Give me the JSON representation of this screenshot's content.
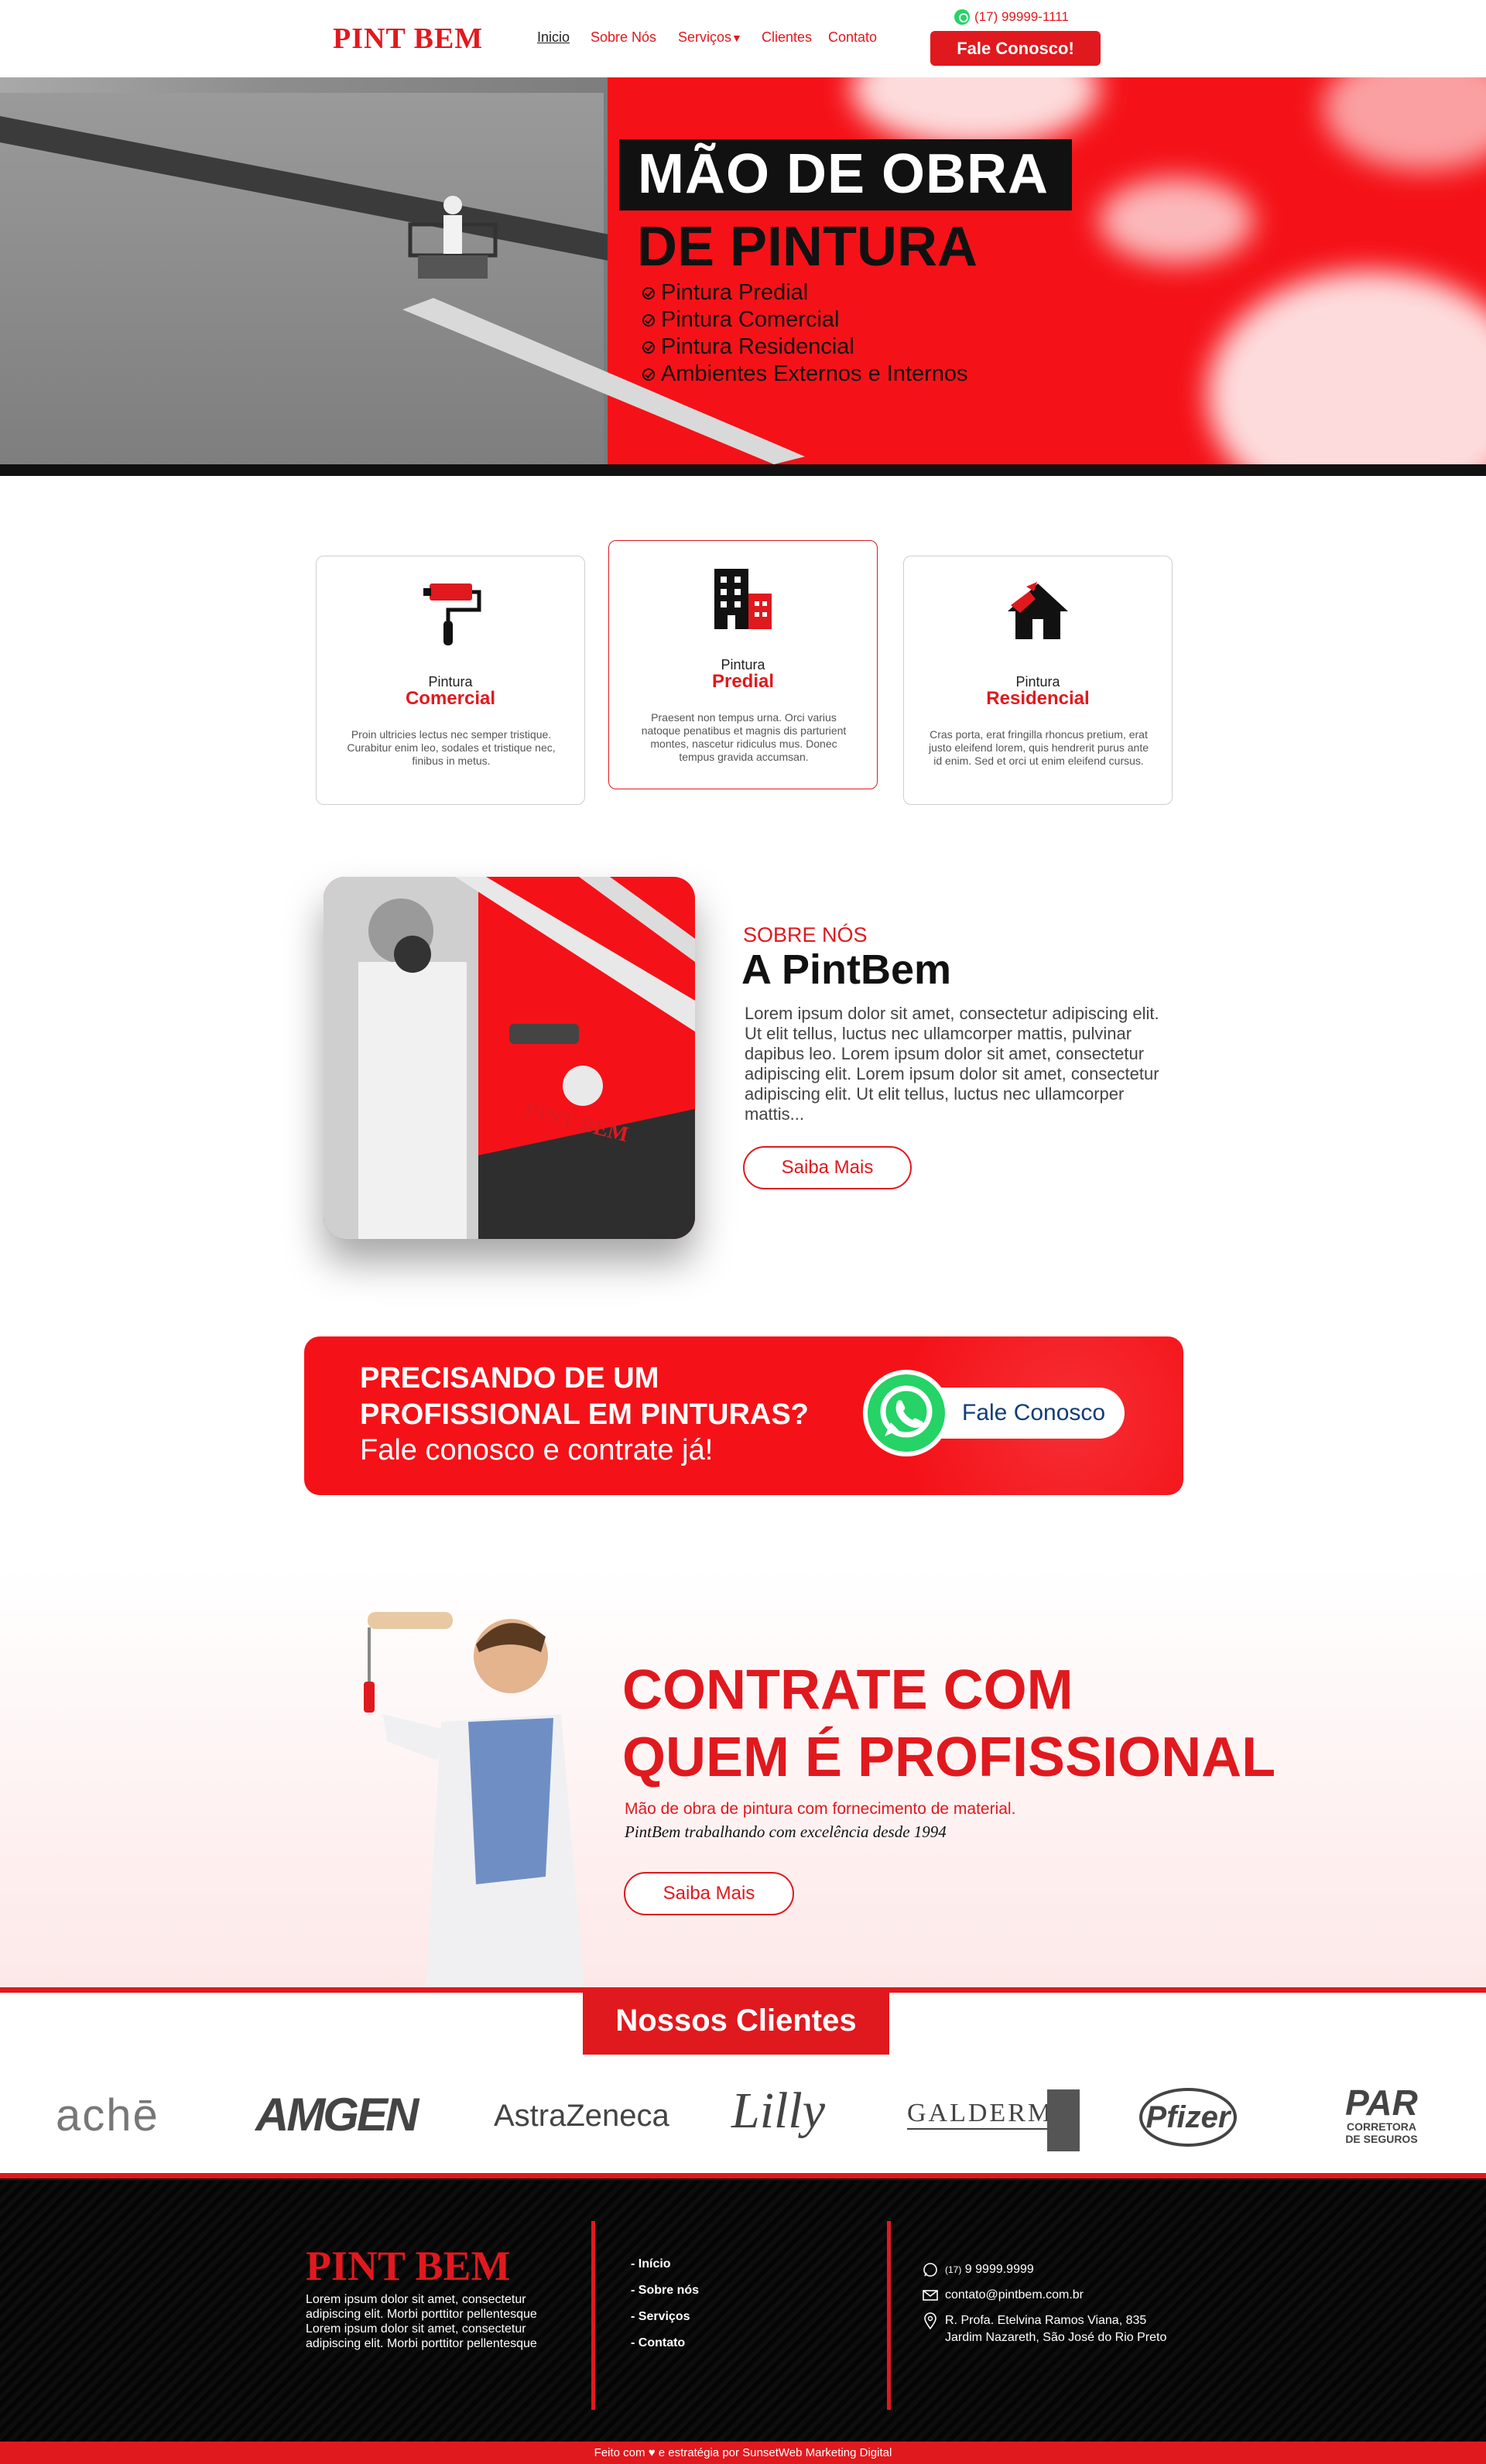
{
  "brand": {
    "name": "PINT BEM",
    "accent": "#e0191e"
  },
  "header": {
    "nav": [
      {
        "label": "Inicio"
      },
      {
        "label": "Sobre Nós"
      },
      {
        "label": "Serviços"
      },
      {
        "label": "Clientes"
      },
      {
        "label": "Contato"
      }
    ],
    "phone": "(17) 99999-1111",
    "cta": "Fale Conosco!"
  },
  "hero": {
    "title_line1": "MÃO DE OBRA",
    "title_line2": "DE PINTURA",
    "items": [
      "Pintura Predial",
      "Pintura Comercial",
      "Pintura Residencial",
      "Ambientes Externos e Internos"
    ]
  },
  "services": [
    {
      "label": "Pintura",
      "title": "Comercial",
      "icon": "paint-roller-icon",
      "desc": "Proin ultricies lectus nec semper tristique. Curabitur enim leo, sodales et tristique nec, finibus in metus."
    },
    {
      "label": "Pintura",
      "title": "Predial",
      "icon": "building-icon",
      "desc": "Praesent non tempus urna. Orci varius natoque penatibus et magnis dis parturient montes, nascetur ridiculus mus. Donec tempus gravida accumsan."
    },
    {
      "label": "Pintura",
      "title": "Residencial",
      "icon": "house-icon",
      "desc": "Cras porta, erat fringilla rhoncus pretium, erat justo eleifend lorem, quis hendrerit purus ante id enim. Sed et orci ut enim eleifend cursus."
    }
  ],
  "about": {
    "eyebrow": "SOBRE NÓS",
    "title": "A PintBem",
    "text": "Lorem ipsum dolor sit amet, consectetur adipiscing elit. Ut elit tellus, luctus nec ullamcorper mattis, pulvinar dapibus leo. Lorem ipsum dolor sit amet, consectetur adipiscing elit. Lorem ipsum dolor sit amet, consectetur adipiscing elit. Ut elit tellus, luctus nec ullamcorper mattis...",
    "button": "Saiba Mais",
    "image_text": "PINT BEM"
  },
  "cta": {
    "line1": "PRECISANDO DE UM",
    "line2": "PROFISSIONAL EM PINTURAS?",
    "line3": "Fale conosco e contrate já!",
    "button": "Fale Conosco"
  },
  "hire": {
    "title_line1": "CONTRATE COM",
    "title_line2": "QUEM É PROFISSIONAL",
    "subtitle": "Mão de obra de pintura com fornecimento de material.",
    "tagline": "PintBem trabalhando com excelência desde 1994",
    "button": "Saiba Mais"
  },
  "clients": {
    "title": "Nossos Clientes",
    "logos": [
      "achē",
      "AMGEN",
      "AstraZeneca",
      "Lilly",
      "GALDERMA",
      "Pfizer",
      "PAR",
      "CORRETORA",
      "DE SEGUROS"
    ]
  },
  "footer": {
    "logo": "PINT BEM",
    "text": "Lorem ipsum dolor sit amet, consectetur adipiscing elit. Morbi porttitor pellentesque Lorem ipsum dolor sit amet, consectetur adipiscing elit. Morbi porttitor pellentesque",
    "links": [
      "- Início",
      "- Sobre nós",
      "- Serviços",
      "- Contato"
    ],
    "phone_prefix": "(17)",
    "phone": "9 9999.9999",
    "email": "contato@pintbem.com.br",
    "address_line1": "R. Profa. Etelvina Ramos Viana, 835",
    "address_line2": "Jardim Nazareth, São José do Rio Preto",
    "credits": "Feito com ♥ e estratégia por SunsetWeb Marketing Digital"
  }
}
